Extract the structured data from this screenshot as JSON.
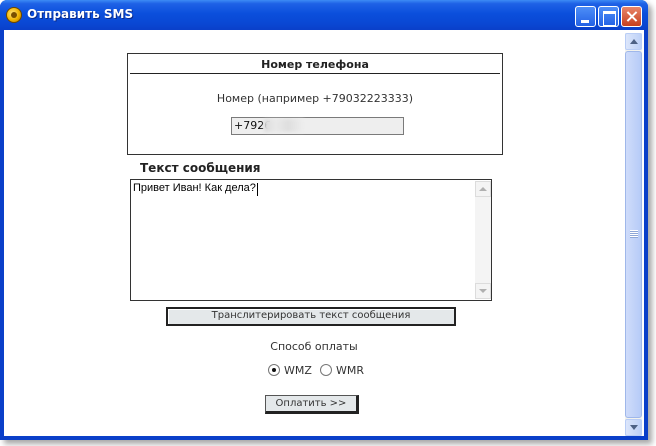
{
  "window": {
    "title": "Отправить SMS",
    "icon": "webmoney-icon",
    "title_color": "#ffffff",
    "titlebar_color": "#0b4fdc"
  },
  "phone": {
    "header": "Номер телефона",
    "hint": "Номер (например +79032223333)",
    "value": "+7926"
  },
  "message": {
    "label": "Текст сообщения",
    "text": "Привет Иван! Как дела?"
  },
  "actions": {
    "transliterate_label": "Транслитерировать текст сообщения",
    "pay_label": "Оплатить >>"
  },
  "payment": {
    "label": "Способ оплаты",
    "options": [
      {
        "label": "WMZ",
        "checked": true
      },
      {
        "label": "WMR",
        "checked": false
      }
    ]
  }
}
